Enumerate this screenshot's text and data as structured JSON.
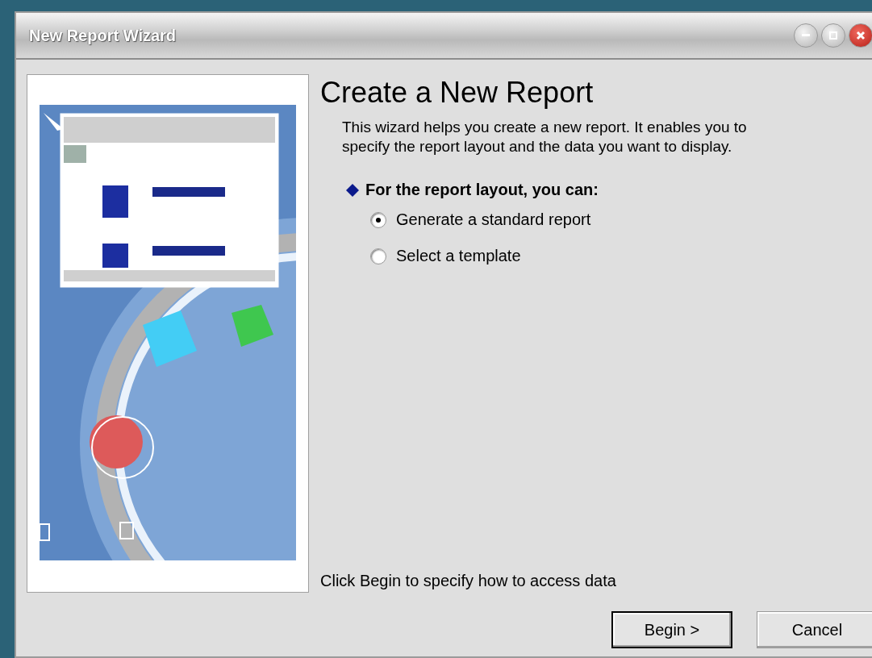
{
  "window": {
    "title": "New Report Wizard"
  },
  "heading": "Create a New Report",
  "description": "This wizard helps you create a new report. It enables you to specify the report layout and the data you want to display.",
  "layout_section": {
    "label": "For the report layout, you can:",
    "options": [
      {
        "label": "Generate a standard report",
        "selected": true
      },
      {
        "label": "Select a template",
        "selected": false
      }
    ]
  },
  "hint": "Click Begin to specify how to access data",
  "buttons": [
    {
      "label": "Begin >",
      "default": true
    },
    {
      "label": "Cancel",
      "default": false
    }
  ]
}
